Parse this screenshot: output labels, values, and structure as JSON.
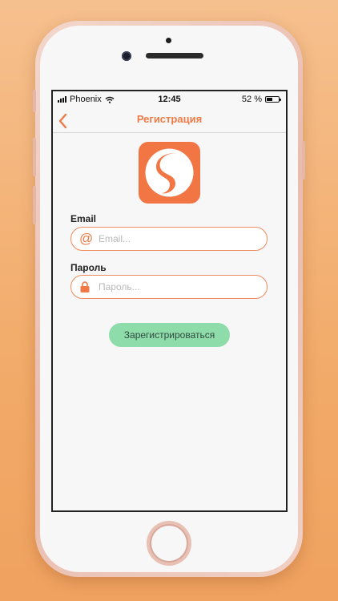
{
  "status_bar": {
    "carrier": "Phoenix",
    "time": "12:45",
    "battery": "52 %",
    "battery_level": 0.52
  },
  "nav": {
    "back_icon": "chevron-left-icon",
    "title": "Регистрация"
  },
  "logo": {
    "icon": "s-logo-icon",
    "color": "#f27544"
  },
  "form": {
    "email_label": "Email",
    "email_placeholder": "Email...",
    "email_value": "",
    "email_icon": "at-icon",
    "password_label": "Пароль",
    "password_placeholder": "Пароль...",
    "password_value": "",
    "password_icon": "lock-icon",
    "submit_label": "Зарегистрироваться"
  },
  "colors": {
    "accent": "#ef7a45",
    "button": "#8fdcab",
    "background": "#f2ab6a"
  }
}
